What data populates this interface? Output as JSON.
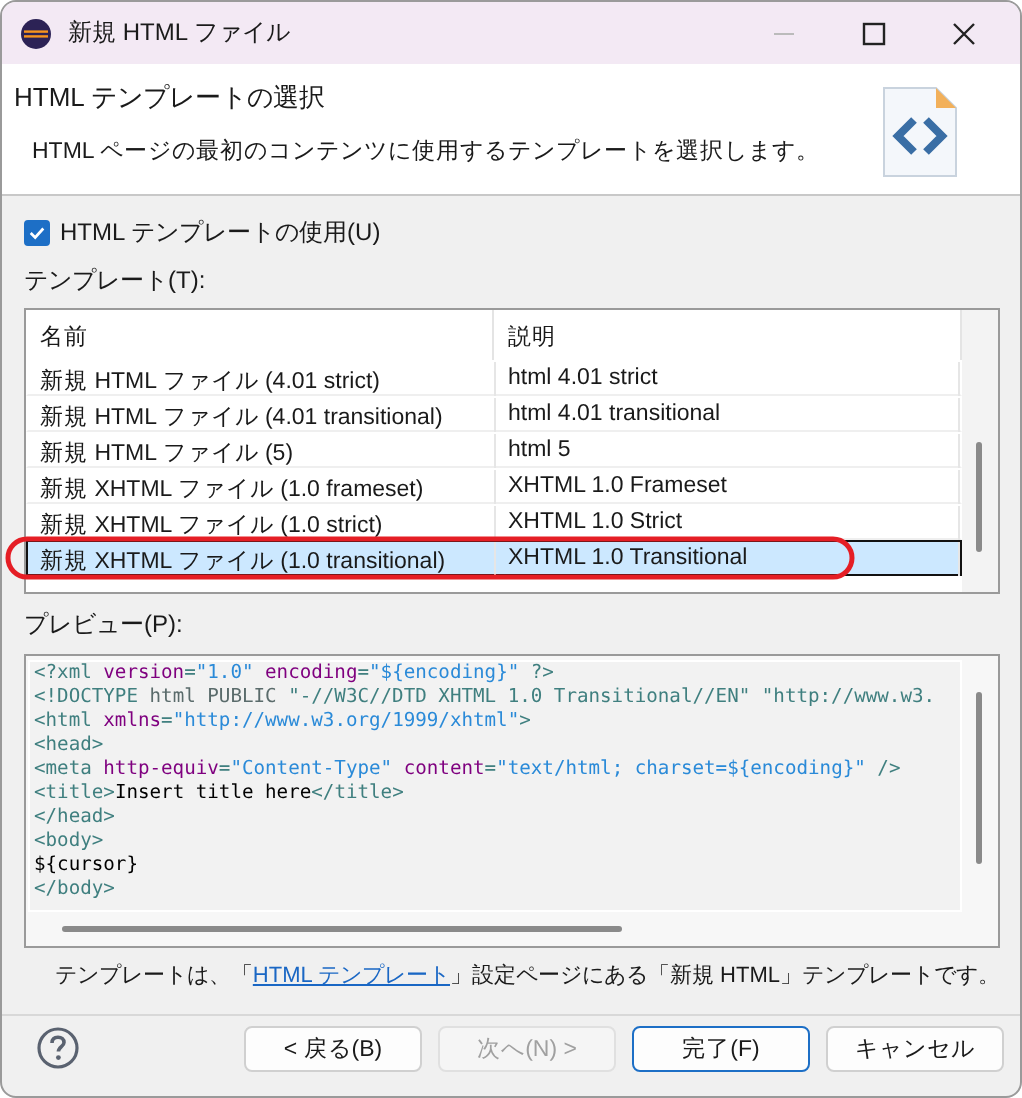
{
  "window": {
    "title": "新規 HTML ファイル"
  },
  "header": {
    "title": "HTML テンプレートの選択",
    "description": "HTML ページの最初のコンテンツに使用するテンプレートを選択します。"
  },
  "use_template": {
    "label": "HTML テンプレートの使用(U)",
    "checked": true
  },
  "templates": {
    "label": "テンプレート(T):",
    "columns": [
      "名前",
      "説明"
    ],
    "rows": [
      {
        "name": "新規 HTML ファイル (4.01 strict)",
        "description": "html 4.01 strict",
        "selected": false
      },
      {
        "name": "新規 HTML ファイル (4.01 transitional)",
        "description": "html 4.01 transitional",
        "selected": false
      },
      {
        "name": "新規 HTML ファイル (5)",
        "description": "html 5",
        "selected": false
      },
      {
        "name": "新規 XHTML ファイル (1.0 frameset)",
        "description": "XHTML 1.0 Frameset",
        "selected": false
      },
      {
        "name": "新規 XHTML ファイル (1.0 strict)",
        "description": "XHTML 1.0 Strict",
        "selected": false
      },
      {
        "name": "新規 XHTML ファイル (1.0 transitional)",
        "description": "XHTML 1.0 Transitional",
        "selected": true
      }
    ]
  },
  "preview": {
    "label": "プレビュー(P):",
    "lines": [
      [
        {
          "kind": "tag",
          "text": "<?xml "
        },
        {
          "kind": "attr",
          "text": "version"
        },
        {
          "kind": "tag",
          "text": "="
        },
        {
          "kind": "value",
          "text": "\"1.0\" "
        },
        {
          "kind": "attr",
          "text": "encoding"
        },
        {
          "kind": "tag",
          "text": "="
        },
        {
          "kind": "value",
          "text": "\"${encoding}\" "
        },
        {
          "kind": "tag",
          "text": "?>"
        }
      ],
      [
        {
          "kind": "tag",
          "text": "<!DOCTYPE "
        },
        {
          "kind": "doctype",
          "text": "html PUBLIC "
        },
        {
          "kind": "tag",
          "text": "\"-//W3C//DTD XHTML 1.0 Transitional//EN\" \"http://www.w3."
        }
      ],
      [
        {
          "kind": "tag",
          "text": "<html "
        },
        {
          "kind": "attr",
          "text": "xmlns"
        },
        {
          "kind": "tag",
          "text": "="
        },
        {
          "kind": "value",
          "text": "\"http://www.w3.org/1999/xhtml\""
        },
        {
          "kind": "tag",
          "text": ">"
        }
      ],
      [
        {
          "kind": "tag",
          "text": "<head>"
        }
      ],
      [
        {
          "kind": "tag",
          "text": "<meta "
        },
        {
          "kind": "attr",
          "text": "http-equiv"
        },
        {
          "kind": "tag",
          "text": "="
        },
        {
          "kind": "value",
          "text": "\"Content-Type\" "
        },
        {
          "kind": "attr",
          "text": "content"
        },
        {
          "kind": "tag",
          "text": "="
        },
        {
          "kind": "value",
          "text": "\"text/html; charset=${encoding}\" "
        },
        {
          "kind": "tag",
          "text": "/>"
        }
      ],
      [
        {
          "kind": "tag",
          "text": "<title>"
        },
        {
          "kind": "text",
          "text": "Insert title here"
        },
        {
          "kind": "tag",
          "text": "</title>"
        }
      ],
      [
        {
          "kind": "tag",
          "text": "</head>"
        }
      ],
      [
        {
          "kind": "tag",
          "text": "<body>"
        }
      ],
      [
        {
          "kind": "text",
          "text": "${cursor}"
        }
      ],
      [
        {
          "kind": "tag",
          "text": "</body>"
        }
      ]
    ]
  },
  "footer_note": {
    "before": "テンプレートは、「",
    "link": "HTML テンプレート",
    "after": "」設定ページにある「新規 HTML」テンプレートです。"
  },
  "buttons": [
    {
      "label": "< 戻る(B)",
      "disabled": false,
      "default": false
    },
    {
      "label": "次へ(N) >",
      "disabled": true,
      "default": false
    },
    {
      "label": "完了(F)",
      "disabled": false,
      "default": true
    },
    {
      "label": "キャンセル",
      "disabled": false,
      "default": false
    }
  ]
}
